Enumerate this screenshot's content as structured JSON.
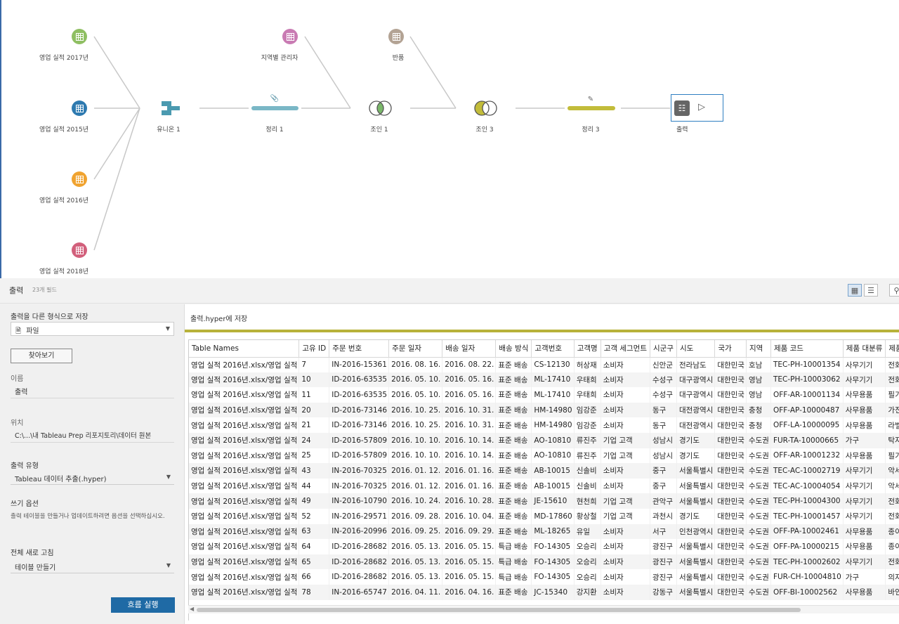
{
  "flow": {
    "inputs": [
      {
        "label": "영업 실적 2017년",
        "color": "#8fbf62"
      },
      {
        "label": "영업 실적 2015년",
        "color": "#2e7ab0"
      },
      {
        "label": "영업 실적 2016년",
        "color": "#f0a330"
      },
      {
        "label": "영업 실적 2018년",
        "color": "#d2607c"
      },
      {
        "label": "지역별 관리자",
        "color": "#c97bb3"
      },
      {
        "label": "반품",
        "color": "#b3a394"
      }
    ],
    "union": {
      "label": "유니온 1",
      "color": "#4b9ab0"
    },
    "clean1": {
      "label": "정리 1",
      "color": "#7ab7c6"
    },
    "join1": {
      "label": "조인 1"
    },
    "join3": {
      "label": "조인 3",
      "color": "#c2bc3a"
    },
    "clean3": {
      "label": "정리 3",
      "color": "#c2bc3a"
    },
    "output": {
      "label": "출력"
    }
  },
  "panel": {
    "title": "출력",
    "field_count": "23개 필드"
  },
  "settings": {
    "save_as_label": "출력을 다른 형식으로 저장",
    "save_as_value": "파일",
    "browse_label": "찾아보기",
    "name_label": "이름",
    "name_value": "출력",
    "location_label": "위치",
    "location_value": "C:\\...\\내 Tableau Prep 리포지토리\\데이터 원본",
    "output_type_label": "출력 유형",
    "output_type_value": "Tableau 데이터 추출(.hyper)",
    "write_options_label": "쓰기 옵션",
    "write_options_help": "출력 테이블을 만들거나 업데이트하려면 옵션을 선택하십시오.",
    "full_refresh_label": "전체 새로 고침",
    "full_refresh_value": "테이블 만들기",
    "run_label": "흐름 실행"
  },
  "preview": {
    "save_target": "출력.hyper에 저장",
    "columns": [
      "Table Names",
      "고유 ID",
      "주문 번호",
      "주문 일자",
      "배송 일자",
      "배송 방식",
      "고객번호",
      "고객명",
      "고객 세그먼트",
      "시군구",
      "시도",
      "국가",
      "지역",
      "제품 코드",
      "제품 대분류",
      "제품 중분류"
    ],
    "rows": [
      [
        "영업 실적 2016년.xlsx/영업 실적",
        "7",
        "IN-2016-15361",
        "2016. 08. 16.",
        "2016. 08. 22.",
        "표준 배송",
        "CS-12130",
        "허상재",
        "소비자",
        "신안군",
        "전라남도",
        "대한민국",
        "호남",
        "TEC-PH-10001354",
        "사무기기",
        "전화기"
      ],
      [
        "영업 실적 2016년.xlsx/영업 실적",
        "10",
        "ID-2016-63535",
        "2016. 05. 10.",
        "2016. 05. 16.",
        "표준 배송",
        "ML-17410",
        "우태희",
        "소비자",
        "수성구",
        "대구광역시",
        "대한민국",
        "영남",
        "TEC-PH-10003062",
        "사무기기",
        "전화기"
      ],
      [
        "영업 실적 2016년.xlsx/영업 실적",
        "11",
        "ID-2016-63535",
        "2016. 05. 10.",
        "2016. 05. 16.",
        "표준 배송",
        "ML-17410",
        "우태희",
        "소비자",
        "수성구",
        "대구광역시",
        "대한민국",
        "영남",
        "OFF-AR-10001134",
        "사무용품",
        "필기구"
      ],
      [
        "영업 실적 2016년.xlsx/영업 실적",
        "20",
        "ID-2016-73146",
        "2016. 10. 25.",
        "2016. 10. 31.",
        "표준 배송",
        "HM-14980",
        "임강준",
        "소비자",
        "동구",
        "대전광역시",
        "대한민국",
        "충청",
        "OFF-AP-10000487",
        "사무용품",
        "가전"
      ],
      [
        "영업 실적 2016년.xlsx/영업 실적",
        "21",
        "ID-2016-73146",
        "2016. 10. 25.",
        "2016. 10. 31.",
        "표준 배송",
        "HM-14980",
        "임강준",
        "소비자",
        "동구",
        "대전광역시",
        "대한민국",
        "충청",
        "OFF-LA-10000095",
        "사무용품",
        "라벨"
      ],
      [
        "영업 실적 2016년.xlsx/영업 실적",
        "24",
        "ID-2016-57809",
        "2016. 10. 10.",
        "2016. 10. 14.",
        "표준 배송",
        "AO-10810",
        "류진주",
        "기업 고객",
        "성남시",
        "경기도",
        "대한민국",
        "수도권",
        "FUR-TA-10000665",
        "가구",
        "탁자"
      ],
      [
        "영업 실적 2016년.xlsx/영업 실적",
        "25",
        "ID-2016-57809",
        "2016. 10. 10.",
        "2016. 10. 14.",
        "표준 배송",
        "AO-10810",
        "류진주",
        "기업 고객",
        "성남시",
        "경기도",
        "대한민국",
        "수도권",
        "OFF-AR-10001232",
        "사무용품",
        "필기구"
      ],
      [
        "영업 실적 2016년.xlsx/영업 실적",
        "43",
        "IN-2016-70325",
        "2016. 01. 12.",
        "2016. 01. 16.",
        "표준 배송",
        "AB-10015",
        "신솔비",
        "소비자",
        "중구",
        "서울특별시",
        "대한민국",
        "수도권",
        "TEC-AC-10002719",
        "사무기기",
        "악세사리"
      ],
      [
        "영업 실적 2016년.xlsx/영업 실적",
        "44",
        "IN-2016-70325",
        "2016. 01. 12.",
        "2016. 01. 16.",
        "표준 배송",
        "AB-10015",
        "신솔비",
        "소비자",
        "중구",
        "서울특별시",
        "대한민국",
        "수도권",
        "TEC-AC-10004054",
        "사무기기",
        "악세사리"
      ],
      [
        "영업 실적 2016년.xlsx/영업 실적",
        "49",
        "IN-2016-10790",
        "2016. 10. 24.",
        "2016. 10. 28.",
        "표준 배송",
        "JE-15610",
        "현천희",
        "기업 고객",
        "관악구",
        "서울특별시",
        "대한민국",
        "수도권",
        "TEC-PH-10004300",
        "사무기기",
        "전화기"
      ],
      [
        "영업 실적 2016년.xlsx/영업 실적",
        "52",
        "IN-2016-29571",
        "2016. 09. 28.",
        "2016. 10. 04.",
        "표준 배송",
        "MD-17860",
        "황상철",
        "기업 고객",
        "과천시",
        "경기도",
        "대한민국",
        "수도권",
        "TEC-PH-10001457",
        "사무기기",
        "전화기"
      ],
      [
        "영업 실적 2016년.xlsx/영업 실적",
        "63",
        "IN-2016-20996",
        "2016. 09. 25.",
        "2016. 09. 29.",
        "표준 배송",
        "ML-18265",
        "유일",
        "소비자",
        "서구",
        "인천광역시",
        "대한민국",
        "수도권",
        "OFF-PA-10002461",
        "사무용품",
        "종이"
      ],
      [
        "영업 실적 2016년.xlsx/영업 실적",
        "64",
        "ID-2016-28682",
        "2016. 05. 13.",
        "2016. 05. 15.",
        "특급 배송",
        "FO-14305",
        "오승리",
        "소비자",
        "광진구",
        "서울특별시",
        "대한민국",
        "수도권",
        "OFF-PA-10000215",
        "사무용품",
        "종이"
      ],
      [
        "영업 실적 2016년.xlsx/영업 실적",
        "65",
        "ID-2016-28682",
        "2016. 05. 13.",
        "2016. 05. 15.",
        "특급 배송",
        "FO-14305",
        "오승리",
        "소비자",
        "광진구",
        "서울특별시",
        "대한민국",
        "수도권",
        "TEC-PH-10002602",
        "사무기기",
        "전화기"
      ],
      [
        "영업 실적 2016년.xlsx/영업 실적",
        "66",
        "ID-2016-28682",
        "2016. 05. 13.",
        "2016. 05. 15.",
        "특급 배송",
        "FO-14305",
        "오승리",
        "소비자",
        "광진구",
        "서울특별시",
        "대한민국",
        "수도권",
        "FUR-CH-10004810",
        "가구",
        "의자"
      ],
      [
        "영업 실적 2016년.xlsx/영업 실적",
        "78",
        "IN-2016-65747",
        "2016. 04. 11.",
        "2016. 04. 16.",
        "표준 배송",
        "JC-15340",
        "강지환",
        "소비자",
        "강동구",
        "서울특별시",
        "대한민국",
        "수도권",
        "OFF-BI-10002562",
        "사무용품",
        "바인더"
      ]
    ]
  }
}
